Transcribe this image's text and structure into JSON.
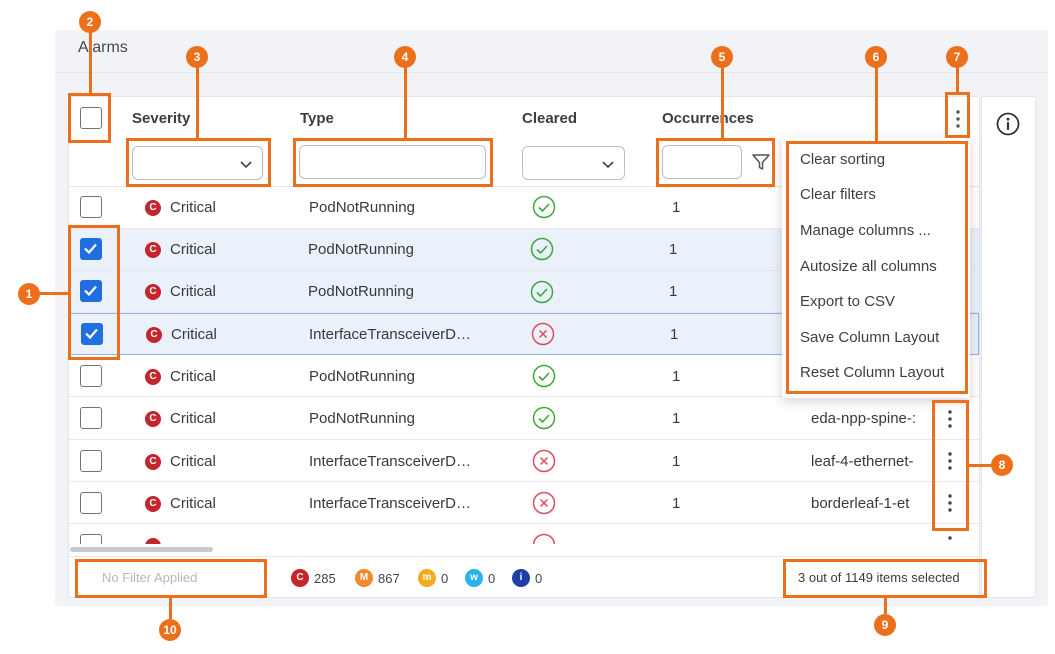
{
  "panel": {
    "title": "Alarms"
  },
  "columns": {
    "severity": "Severity",
    "type": "Type",
    "cleared": "Cleared",
    "occurrences": "Occurrences"
  },
  "rows": [
    {
      "checked": false,
      "severity": "Critical",
      "severity_badge": "C",
      "type": "PodNotRunning",
      "cleared": true,
      "occurrences": "1",
      "resource": ""
    },
    {
      "checked": true,
      "severity": "Critical",
      "severity_badge": "C",
      "type": "PodNotRunning",
      "cleared": true,
      "occurrences": "1",
      "resource": ""
    },
    {
      "checked": true,
      "severity": "Critical",
      "severity_badge": "C",
      "type": "PodNotRunning",
      "cleared": true,
      "occurrences": "1",
      "resource": ""
    },
    {
      "checked": true,
      "severity": "Critical",
      "severity_badge": "C",
      "type": "InterfaceTransceiverD…",
      "cleared": false,
      "occurrences": "1",
      "resource": ""
    },
    {
      "checked": false,
      "severity": "Critical",
      "severity_badge": "C",
      "type": "PodNotRunning",
      "cleared": true,
      "occurrences": "1",
      "resource": ""
    },
    {
      "checked": false,
      "severity": "Critical",
      "severity_badge": "C",
      "type": "PodNotRunning",
      "cleared": true,
      "occurrences": "1",
      "resource": "eda-npp-spine-:"
    },
    {
      "checked": false,
      "severity": "Critical",
      "severity_badge": "C",
      "type": "InterfaceTransceiverD…",
      "cleared": false,
      "occurrences": "1",
      "resource": "leaf-4-ethernet-"
    },
    {
      "checked": false,
      "severity": "Critical",
      "severity_badge": "C",
      "type": "InterfaceTransceiverD…",
      "cleared": false,
      "occurrences": "1",
      "resource": "borderleaf-1-et"
    }
  ],
  "menu": {
    "items": [
      "Clear sorting",
      "Clear filters",
      "Manage columns ...",
      "Autosize all columns",
      "Export to CSV",
      "Save Column Layout",
      "Reset Column Layout"
    ]
  },
  "footer": {
    "filter_status": "No Filter Applied",
    "counts": [
      {
        "letter": "C",
        "value": "285",
        "color": "#c5252c"
      },
      {
        "letter": "M",
        "value": "867",
        "color": "#f08a2c"
      },
      {
        "letter": "m",
        "value": "0",
        "color": "#f3ac1e"
      },
      {
        "letter": "w",
        "value": "0",
        "color": "#2bb3e8"
      },
      {
        "letter": "i",
        "value": "0",
        "color": "#1f3fa8"
      }
    ],
    "selection_summary": "3 out of 1149 items selected"
  },
  "annotations": [
    "1",
    "2",
    "3",
    "4",
    "5",
    "6",
    "7",
    "8",
    "9",
    "10"
  ],
  "colors": {
    "accent": "#ec6f1b",
    "checkbox": "#1f6fe0",
    "critical": "#c5252c",
    "cleared_ok": "#3aa93a",
    "cleared_no": "#e04b5a"
  }
}
